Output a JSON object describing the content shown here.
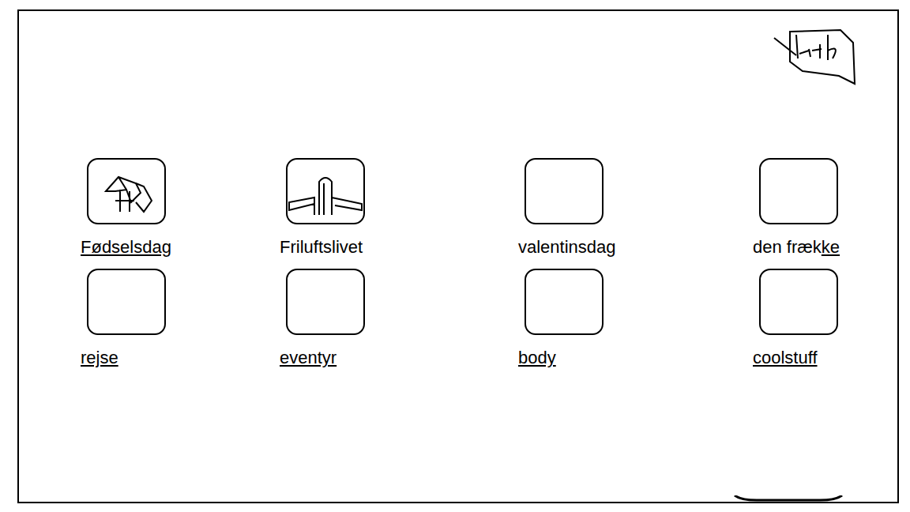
{
  "tiles": [
    {
      "label": "Fødselsdag",
      "kind": "gift",
      "underline_start": 0
    },
    {
      "label": "Friluftslivet",
      "kind": "outdoor",
      "underline_start": -1
    },
    {
      "label": "valentinsdag",
      "kind": "empty",
      "underline_start": -1
    },
    {
      "label": "den frække",
      "kind": "empty",
      "underline_start": 8
    },
    {
      "label": "rejse",
      "kind": "empty",
      "underline_start": 0
    },
    {
      "label": "eventyr",
      "kind": "empty",
      "underline_start": 0
    },
    {
      "label": "body",
      "kind": "empty",
      "underline_start": 0
    },
    {
      "label": "coolstuff",
      "kind": "empty",
      "underline_start": 0
    }
  ]
}
